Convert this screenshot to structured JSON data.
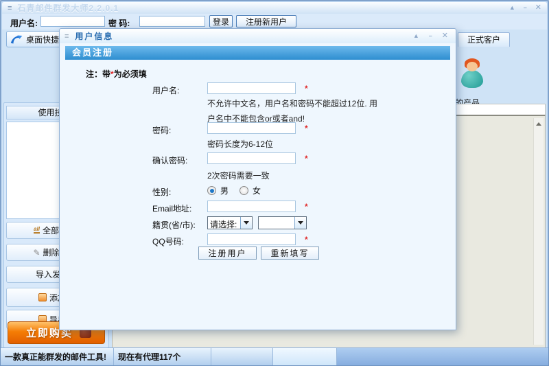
{
  "icons": {
    "menu": "≡",
    "rollup": "▲",
    "minimize": "–",
    "close": "✕",
    "all": "all",
    "eraser": "✎"
  },
  "colors": {
    "header_blue": "#3b97d3",
    "buy_orange": "#f57d05",
    "required_red": "#e02a2a"
  },
  "window": {
    "title": "石青邮件群发大师2.2.0.1"
  },
  "login": {
    "username_label": "用户名:",
    "password_label": "密 码:",
    "login_button": "登录",
    "register_button": "注册新用户"
  },
  "toolbar": {
    "desktop_shortcut": "桌面快捷",
    "client_tab": "正式客户"
  },
  "right_panel": {
    "products_label": "的产品"
  },
  "sidebar": {
    "tips_header": "使用技巧",
    "buttons": [
      {
        "label": "全部选中"
      },
      {
        "label": "删除勾选"
      },
      {
        "label": "导入发"
      },
      {
        "label": "添加"
      },
      {
        "label": "导出"
      }
    ],
    "buy_button": "立即购买"
  },
  "statusbar": {
    "slogan": "一款真正能群发的邮件工具!",
    "agents": "现在有代理117个"
  },
  "dialog": {
    "title": "用户信息",
    "header": "会员注册",
    "note": {
      "prefix": "注：带",
      "star": "*",
      "suffix": "为必须填"
    },
    "required_mark": "*",
    "form": {
      "username": {
        "label": "用户名:",
        "note1": "不允许中文名，用户名和密码不能超过12位. 用",
        "note2": "户名中不能包含or或者and!"
      },
      "password": {
        "label": "密码:",
        "note": "密码长度为6-12位"
      },
      "confirm": {
        "label": "确认密码:",
        "note": "2次密码需要一致"
      },
      "gender": {
        "label": "性别:",
        "male": "男",
        "female": "女"
      },
      "email": {
        "label": "Email地址:"
      },
      "hometown": {
        "label": "籍贯(省/市):",
        "province": "请选择:"
      },
      "qq": {
        "label": "QQ号码:"
      },
      "submit": "注册用户",
      "reset": "重新填写"
    }
  }
}
